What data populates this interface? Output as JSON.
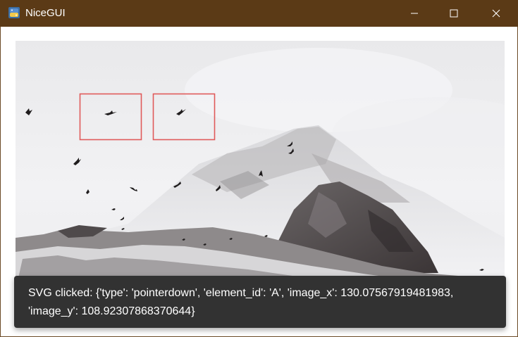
{
  "window": {
    "title": "NiceGUI",
    "icon": "python-icon",
    "controls": [
      "minimize-icon",
      "maximize-icon",
      "close-icon"
    ]
  },
  "image": {
    "description_icon": "interactive-image",
    "selection_color": "#e05a5a"
  },
  "notification": {
    "message": "SVG clicked: {'type': 'pointerdown', 'element_id': 'A', 'image_x': 130.07567919481983, 'image_y': 108.92307868370644}"
  },
  "colors": {
    "titlebar": "#5b3a16",
    "notification_bg": "#323232",
    "notification_text": "#ffffff"
  }
}
